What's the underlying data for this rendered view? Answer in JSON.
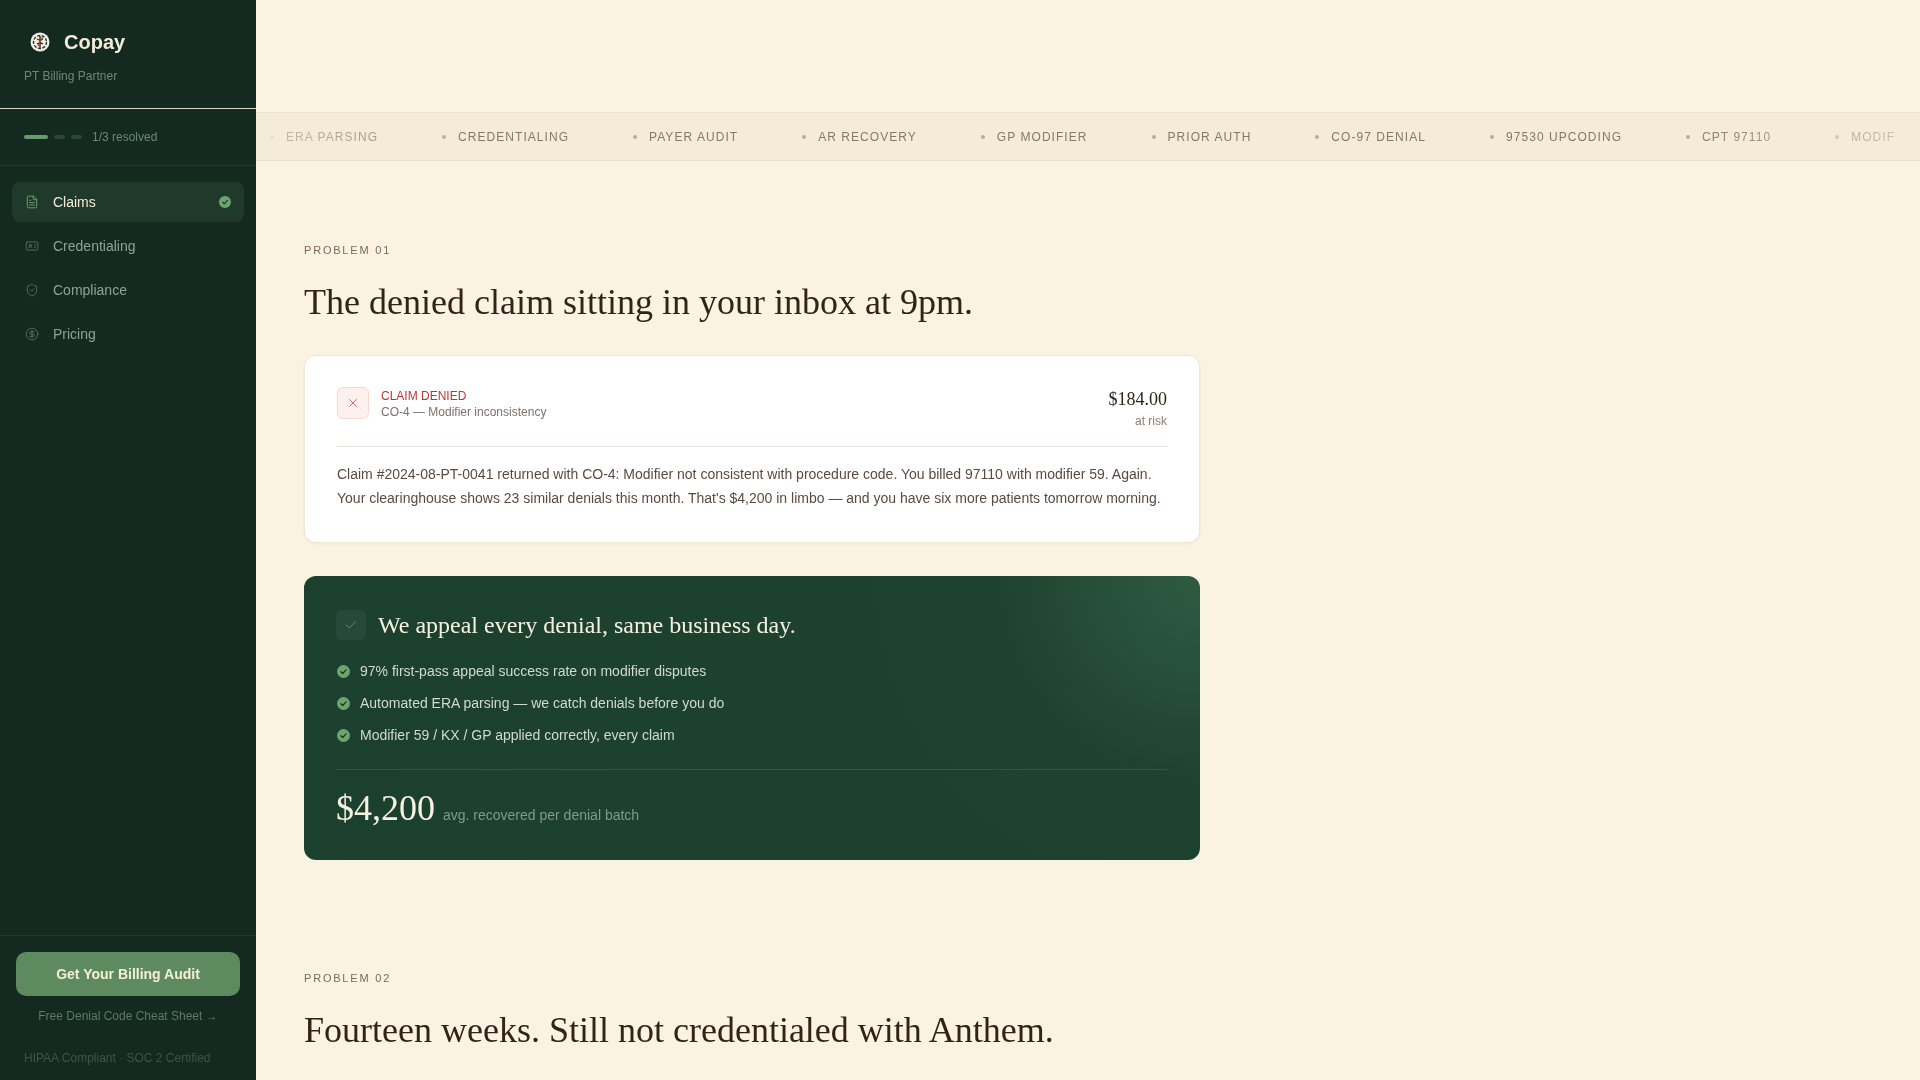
{
  "sidebar": {
    "brand": {
      "name": "Copay",
      "tagline": "PT Billing Partner"
    },
    "progress": {
      "segments": [
        {
          "done": true
        },
        {
          "done": false
        },
        {
          "done": false
        }
      ],
      "label": "1/3 resolved"
    },
    "nav": [
      {
        "label": "Claims",
        "selected": true,
        "resolved": true
      },
      {
        "label": "Credentialing",
        "selected": false,
        "resolved": false
      },
      {
        "label": "Compliance",
        "selected": false,
        "resolved": false
      },
      {
        "label": "Pricing",
        "selected": false,
        "resolved": false
      }
    ],
    "cta_button": "Get Your Billing Audit",
    "secondary_link": "Free Denial Code Cheat Sheet →",
    "footer_note": "HIPAA Compliant · SOC 2 Certified"
  },
  "ticker": [
    "ERA PARSING",
    "CREDENTIALING",
    "PAYER AUDIT",
    "AR RECOVERY",
    "GP MODIFIER",
    "PRIOR AUTH",
    "CO-97 DENIAL",
    "97530 UPCODING",
    "CPT 97110",
    "MODIF"
  ],
  "problems": [
    {
      "eyebrow": "PROBLEM 01",
      "title": "The denied claim sitting in your inbox at 9pm.",
      "denial_card": {
        "status": "CLAIM DENIED",
        "reason": "CO-4 — Modifier inconsistency",
        "amount": "$184.00",
        "amount_caption": "at risk",
        "body": "Claim #2024-08-PT-0041 returned with CO-4: Modifier not consistent with procedure code. You billed 97110 with modifier 59. Again. Your clearinghouse shows 23 similar denials this month. That's $4,200 in limbo — and you have six more patients tomorrow morning."
      },
      "solution_card": {
        "title": "We appeal every denial, same business day.",
        "points": [
          "97% first-pass appeal success rate on modifier disputes",
          "Automated ERA parsing — we catch denials before you do",
          "Modifier 59 / KX / GP applied correctly, every claim"
        ],
        "stat": "$4,200",
        "stat_caption": "avg. recovered per denial batch"
      }
    },
    {
      "eyebrow": "PROBLEM 02",
      "title": "Fourteen weeks. Still not credentialed with Anthem."
    }
  ]
}
